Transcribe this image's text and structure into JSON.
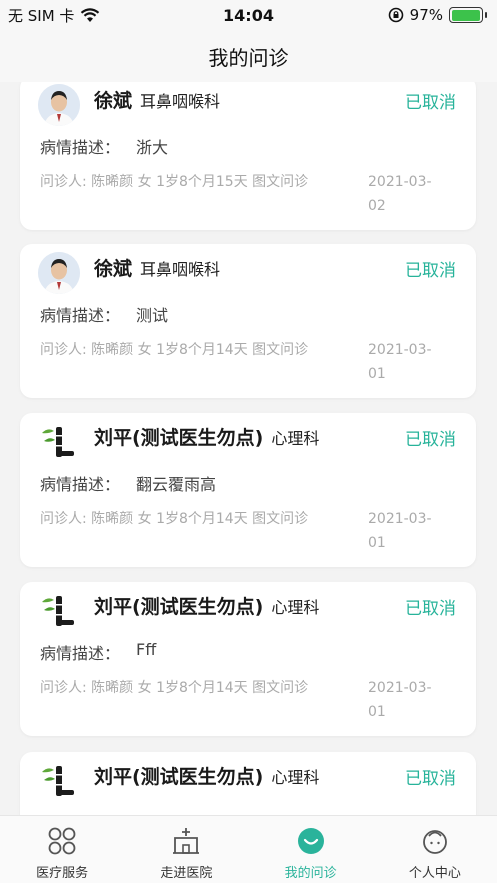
{
  "status_bar": {
    "carrier": "无 SIM 卡",
    "time": "14:04",
    "battery": "97%"
  },
  "nav": {
    "title": "我的问诊"
  },
  "colors": {
    "accent": "#27b39a",
    "battery": "#3cc24b"
  },
  "consultations": [
    {
      "doctor": "徐斌",
      "dept": "耳鼻咽喉科",
      "status": "已取消",
      "desc_label": "病情描述：",
      "desc": "浙大",
      "meta": "问诊人: 陈晞颜 女 1岁8个月15天 图文问诊",
      "date": "2021-03-02",
      "avatar": "doctor-photo"
    },
    {
      "doctor": "徐斌",
      "dept": "耳鼻咽喉科",
      "status": "已取消",
      "desc_label": "病情描述：",
      "desc": "测试",
      "meta": "问诊人: 陈晞颜 女 1岁8个月14天 图文问诊",
      "date": "2021-03-01",
      "avatar": "doctor-photo"
    },
    {
      "doctor": "刘平(测试医生勿点)",
      "dept": "心理科",
      "status": "已取消",
      "desc_label": "病情描述：",
      "desc": "翻云覆雨高",
      "meta": "问诊人: 陈晞颜 女 1岁8个月14天 图文问诊",
      "date": "2021-03-01",
      "avatar": "bamboo-logo"
    },
    {
      "doctor": "刘平(测试医生勿点)",
      "dept": "心理科",
      "status": "已取消",
      "desc_label": "病情描述：",
      "desc": "Fff",
      "meta": "问诊人: 陈晞颜 女 1岁8个月14天 图文问诊",
      "date": "2021-03-01",
      "avatar": "bamboo-logo"
    },
    {
      "doctor": "刘平(测试医生勿点)",
      "dept": "心理科",
      "status": "已取消",
      "avatar": "bamboo-logo"
    }
  ],
  "tabs": [
    {
      "label": "医疗服务",
      "icon": "grid-icon",
      "active": false
    },
    {
      "label": "走进医院",
      "icon": "hospital-icon",
      "active": false
    },
    {
      "label": "我的问诊",
      "icon": "chat-icon",
      "active": true
    },
    {
      "label": "个人中心",
      "icon": "person-icon",
      "active": false
    }
  ]
}
